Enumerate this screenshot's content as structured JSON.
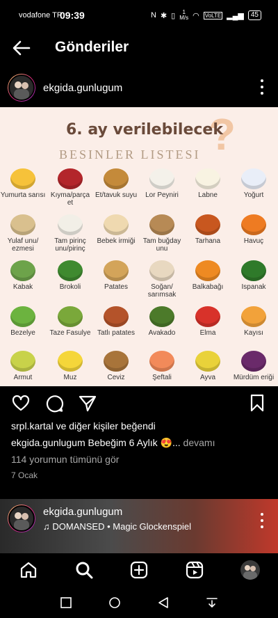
{
  "status": {
    "carrier": "vodafone TR",
    "time": "09:39",
    "speed": "1\nM/s",
    "volte": "VoLTE",
    "battery": "45"
  },
  "header": {
    "title": "Gönderiler"
  },
  "post": {
    "username": "ekgida.gunlugum",
    "image": {
      "title": "6. ay verilebilecek",
      "subtitle": "BESINLER LISTESI",
      "foods": [
        {
          "label": "Yumurta sarısı",
          "color": "#f6c23a"
        },
        {
          "label": "Kıyma/parça et",
          "color": "#b3262b"
        },
        {
          "label": "Et/tavuk suyu",
          "color": "#c48a3a"
        },
        {
          "label": "Lor Peyniri",
          "color": "#f4f1ea"
        },
        {
          "label": "Labne",
          "color": "#f8f3e2"
        },
        {
          "label": "Yoğurt",
          "color": "#e9eef8"
        },
        {
          "label": "Yulaf unu/ ezmesi",
          "color": "#d9c08e"
        },
        {
          "label": "Tam pirinç unu/pirinç",
          "color": "#f2efe7"
        },
        {
          "label": "Bebek irmiği",
          "color": "#efd9b0"
        },
        {
          "label": "Tam buğday unu",
          "color": "#b78a55"
        },
        {
          "label": "Tarhana",
          "color": "#c8571f"
        },
        {
          "label": "Havuç",
          "color": "#ee7b22"
        },
        {
          "label": "Kabak",
          "color": "#6da34a"
        },
        {
          "label": "Brokoli",
          "color": "#3f8a2f"
        },
        {
          "label": "Patates",
          "color": "#d3a45a"
        },
        {
          "label": "Soğan/ sarımsak",
          "color": "#e8d8c0"
        },
        {
          "label": "Balkabağı",
          "color": "#ee8a22"
        },
        {
          "label": "Ispanak",
          "color": "#2f7a2a"
        },
        {
          "label": "Bezelye",
          "color": "#6cb33f"
        },
        {
          "label": "Taze Fasulye",
          "color": "#7aa83a"
        },
        {
          "label": "Tatlı patates",
          "color": "#b4532a"
        },
        {
          "label": "Avakado",
          "color": "#4c7a2a"
        },
        {
          "label": "Elma",
          "color": "#d8322a"
        },
        {
          "label": "Kayısı",
          "color": "#f2a23a"
        },
        {
          "label": "Armut",
          "color": "#c8d24a"
        },
        {
          "label": "Muz",
          "color": "#f5d63a"
        },
        {
          "label": "Ceviz",
          "color": "#a8743a"
        },
        {
          "label": "Şeftali",
          "color": "#f28a5a"
        },
        {
          "label": "Ayva",
          "color": "#e9d23a"
        },
        {
          "label": "Mürdüm eriği",
          "color": "#6a2a6a"
        }
      ]
    },
    "likes_user": "srpl.kartal",
    "likes_rest": " ve diğer kişiler beğendi",
    "caption_user": "ekgida.gunlugum",
    "caption_text": " Bebeğim 6 Aylık 😍...",
    "caption_more": " devamı",
    "comments": "114 yorumun tümünü gör",
    "date": "7 Ocak"
  },
  "post2": {
    "username": "ekgida.gunlugum",
    "music": "DOMANSED • Magic Glockenspiel"
  },
  "icons": {
    "back": "arrow-left-icon",
    "heart": "heart-icon",
    "comment": "comment-icon",
    "share": "send-icon",
    "save": "bookmark-icon",
    "music": "music-note-icon",
    "home": "home-icon",
    "search": "search-icon",
    "create": "plus-square-icon",
    "reels": "reels-icon",
    "profile": "profile-avatar"
  }
}
